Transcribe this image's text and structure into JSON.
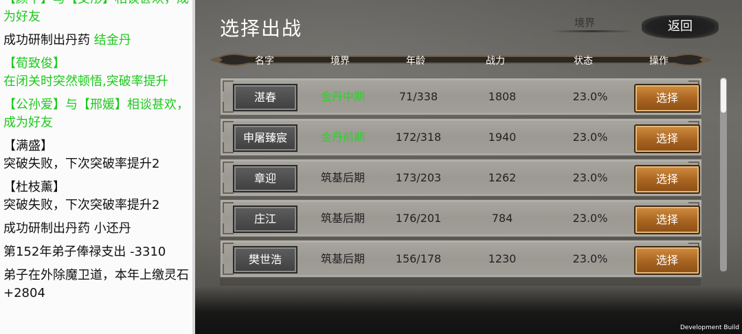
{
  "log": {
    "entries": [
      {
        "text": "【颜平】与【艾彤】相谈甚欢，成为好友",
        "color": "green",
        "first": true
      },
      {
        "text": "成功研制出丹药 ",
        "highlight": "结金丹",
        "color": "black"
      },
      {
        "text": "【荀致俊】",
        "color": "green"
      },
      {
        "text": "在闭关时突然顿悟,突破率提升",
        "color": "green"
      },
      {
        "text": "【公孙爱】与【邢媛】相谈甚欢，成为好友",
        "color": "green"
      },
      {
        "text": "【满盛】",
        "color": "black"
      },
      {
        "text": "突破失败，下次突破率提升2",
        "color": "black"
      },
      {
        "text": "【杜枝薰】",
        "color": "black"
      },
      {
        "text": "突破失败，下次突破率提升2",
        "color": "black"
      },
      {
        "text": "成功研制出丹药 小还丹",
        "color": "black"
      },
      {
        "text": "第152年弟子俸禄支出 -3310",
        "color": "black"
      },
      {
        "text": "弟子在外除魔卫道，本年上缴灵石 +2804",
        "color": "black"
      }
    ]
  },
  "screen": {
    "title": "选择出战",
    "realm_filter": "境界",
    "back_label": "返回",
    "dev_build": "Development Build"
  },
  "columns": [
    "名字",
    "境界",
    "年龄",
    "战力",
    "状态",
    "操作"
  ],
  "rows": [
    {
      "name": "湛春",
      "realm": "金丹中期",
      "realm_tier": "gold",
      "age": "71/338",
      "power": "1808",
      "status": "23.0%",
      "action": "选择"
    },
    {
      "name": "申屠臻宸",
      "realm": "金丹前期",
      "realm_tier": "gold",
      "age": "172/318",
      "power": "1940",
      "status": "23.0%",
      "action": "选择"
    },
    {
      "name": "章迎",
      "realm": "筑基后期",
      "realm_tier": "base",
      "age": "173/203",
      "power": "1262",
      "status": "23.0%",
      "action": "选择"
    },
    {
      "name": "庄江",
      "realm": "筑基后期",
      "realm_tier": "base",
      "age": "176/201",
      "power": "784",
      "status": "23.0%",
      "action": "选择"
    },
    {
      "name": "樊世浩",
      "realm": "筑基后期",
      "realm_tier": "base",
      "age": "156/178",
      "power": "1230",
      "status": "23.0%",
      "action": "选择"
    }
  ],
  "colors": {
    "realm_gold": "#2ed12e",
    "button": "#a7631f",
    "log_green": "#1ec91e"
  }
}
